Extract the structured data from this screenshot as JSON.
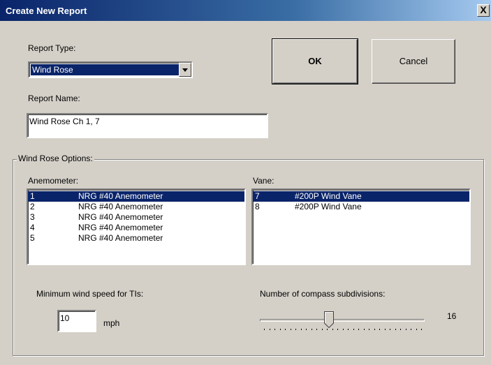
{
  "window": {
    "title": "Create New Report",
    "close_glyph": "X"
  },
  "report_type": {
    "label": "Report Type:",
    "selected": "Wind Rose"
  },
  "report_name": {
    "label": "Report Name:",
    "value": "Wind Rose Ch 1, 7"
  },
  "buttons": {
    "ok": "OK",
    "cancel": "Cancel"
  },
  "options": {
    "legend": "Wind Rose Options:",
    "anemometer": {
      "label": "Anemometer:",
      "items": [
        {
          "id": "1",
          "name": "NRG #40 Anemometer",
          "selected": true
        },
        {
          "id": "2",
          "name": "NRG #40 Anemometer",
          "selected": false
        },
        {
          "id": "3",
          "name": "NRG #40 Anemometer",
          "selected": false
        },
        {
          "id": "4",
          "name": "NRG #40 Anemometer",
          "selected": false
        },
        {
          "id": "5",
          "name": "NRG #40 Anemometer",
          "selected": false
        }
      ]
    },
    "vane": {
      "label": "Vane:",
      "items": [
        {
          "id": "7",
          "name": "#200P Wind Vane",
          "selected": true
        },
        {
          "id": "8",
          "name": "#200P Wind Vane",
          "selected": false
        }
      ]
    },
    "min_speed": {
      "label": "Minimum wind speed for TIs:",
      "value": "10",
      "unit": "mph"
    },
    "subdivisions": {
      "label": "Number of compass subdivisions:",
      "value": "16",
      "slider_fraction": 0.42
    }
  },
  "colors": {
    "selection": "#0a246a",
    "dialog_bg": "#d4d0c8",
    "titlebar": "#0a246a"
  }
}
